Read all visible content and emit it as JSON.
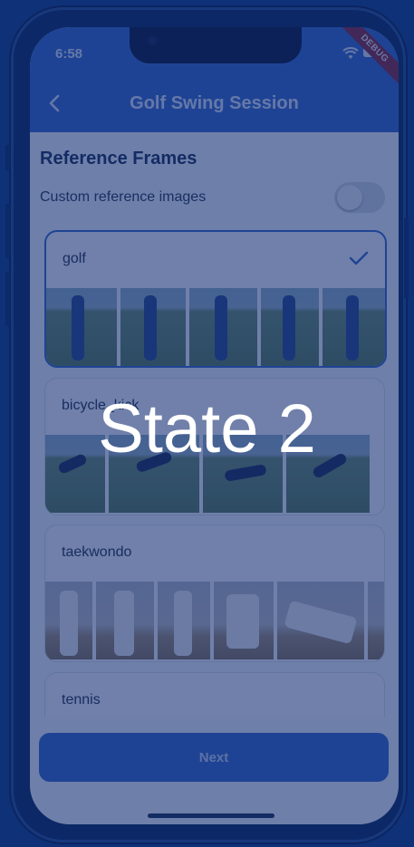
{
  "status_bar": {
    "time": "6:58",
    "debug_label": "DEBUG"
  },
  "header": {
    "title": "Golf Swing Session",
    "back_icon": "chevron-left-icon"
  },
  "section": {
    "title": "Reference Frames"
  },
  "custom_toggle": {
    "label": "Custom reference images",
    "enabled": false
  },
  "reference_sets": [
    {
      "label": "golf",
      "selected": true,
      "scene": "grass",
      "frames": 5
    },
    {
      "label": "bicycle_kick",
      "selected": false,
      "scene": "grass",
      "frames": 4
    },
    {
      "label": "taekwondo",
      "selected": false,
      "scene": "hall",
      "frames": 6
    },
    {
      "label": "tennis",
      "selected": false,
      "scene": "court",
      "frames": 0
    }
  ],
  "footer": {
    "next_label": "Next"
  },
  "overlay": {
    "label": "State 2"
  },
  "colors": {
    "primary": "#3a69c9",
    "overlay": "#0c286e"
  }
}
